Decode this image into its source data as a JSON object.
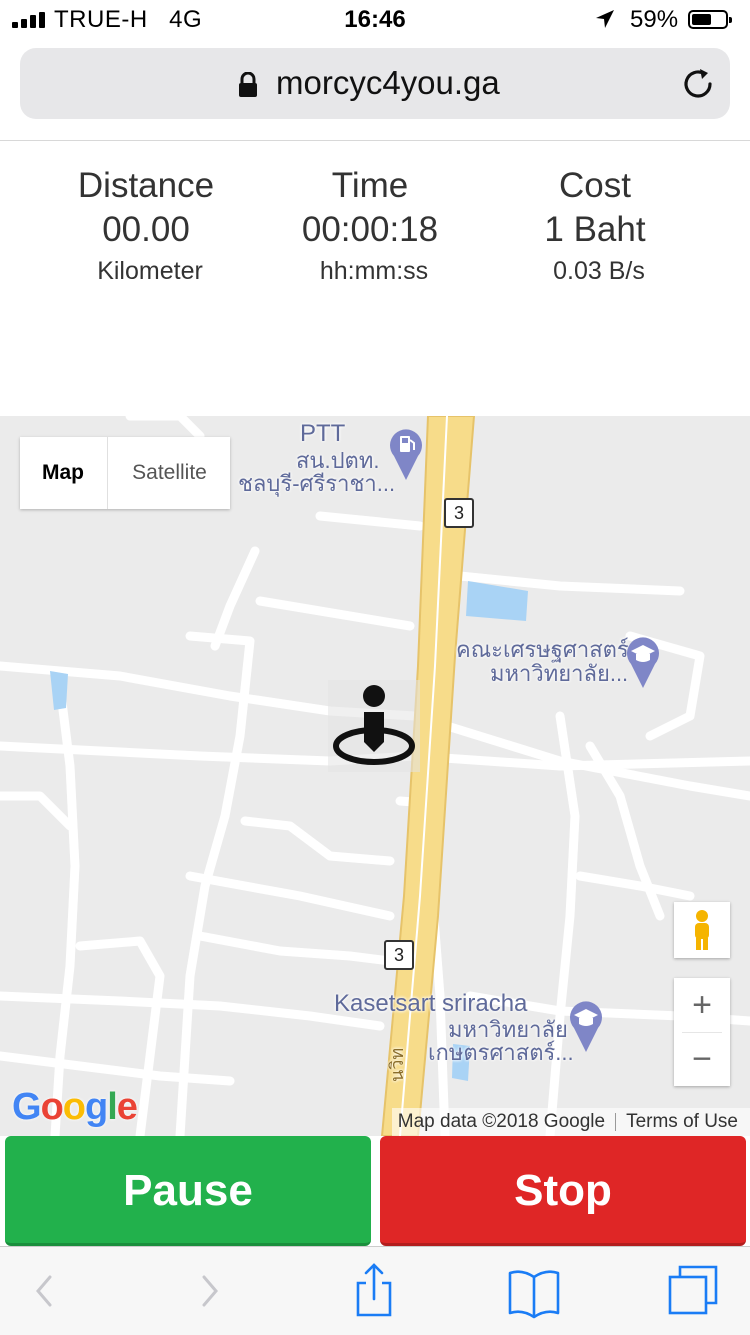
{
  "status_bar": {
    "carrier": "TRUE-H",
    "network": "4G",
    "time": "16:46",
    "battery_percent": "59%",
    "battery_level": 0.59
  },
  "browser": {
    "url": "morcyc4you.ga"
  },
  "stats": {
    "distance": {
      "label": "Distance",
      "value": "00.00",
      "unit": "Kilometer"
    },
    "time": {
      "label": "Time",
      "value": "00:00:18",
      "unit": "hh:mm:ss"
    },
    "cost": {
      "label": "Cost",
      "value": "1 Baht",
      "unit": "0.03 B/s"
    }
  },
  "map": {
    "type_map_label": "Map",
    "type_satellite_label": "Satellite",
    "poi_ptt_title": "PTT",
    "poi_ptt_line1": "สน.ปตท.",
    "poi_ptt_line2": "ชลบุรี-ศรีราชา...",
    "poi_econ_line1": "คณะเศรษฐศาสตร์",
    "poi_econ_line2": "มหาวิทยาลัย...",
    "poi_kasetsart_title": "Kasetsart sriracha",
    "poi_kasetsart_line1": "มหาวิทยาลัย",
    "poi_kasetsart_line2": "เกษตรศาสตร์...",
    "road_number": "3",
    "road_name_partial": "นวิท",
    "zoom_in": "+",
    "zoom_out": "−",
    "google_logo": "Google",
    "map_data": "Map data ©2018 Google",
    "terms": "Terms of Use"
  },
  "actions": {
    "pause": "Pause",
    "stop": "Stop"
  },
  "colors": {
    "pause": "#22b14c",
    "stop": "#df2626",
    "highway": "#f7dc8a",
    "water": "#a9d3f5",
    "poi": "#7f86c7"
  }
}
